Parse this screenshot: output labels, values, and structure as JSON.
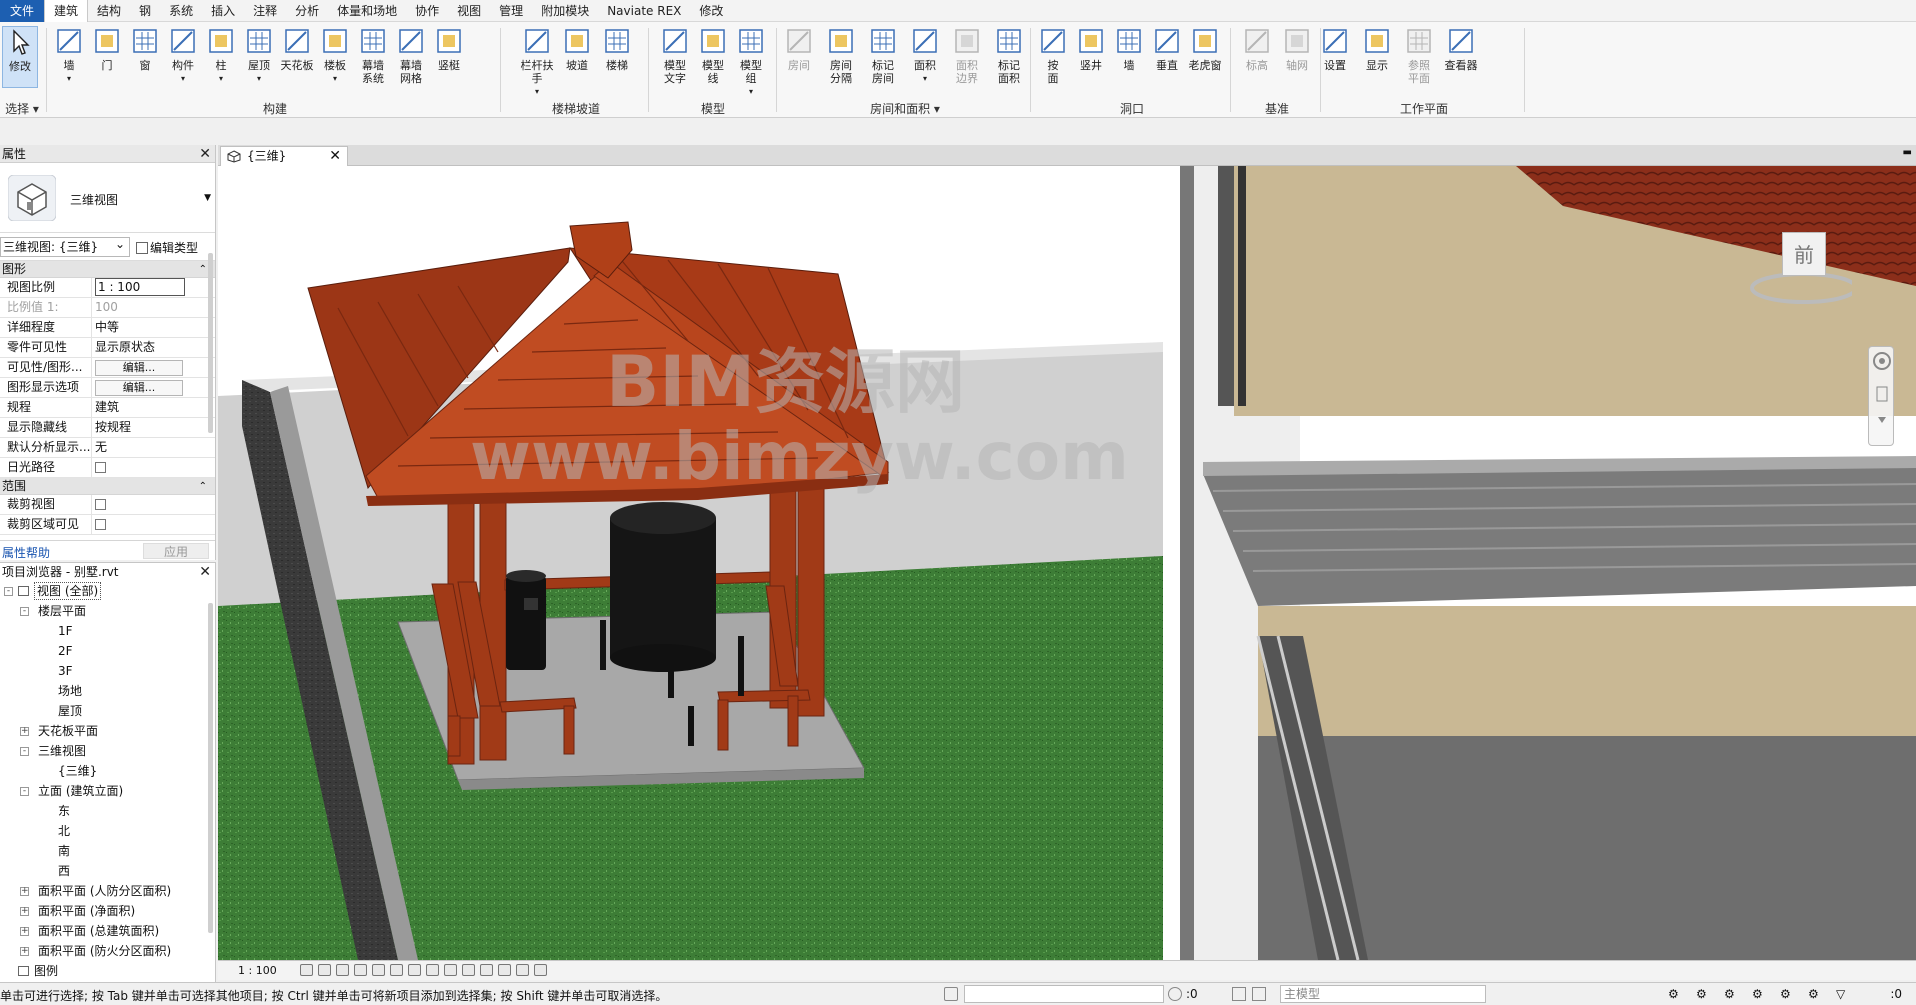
{
  "menu": {
    "tabs": [
      "文件",
      "建筑",
      "结构",
      "钢",
      "系统",
      "插入",
      "注释",
      "分析",
      "体量和场地",
      "协作",
      "视图",
      "管理",
      "附加模块",
      "Naviate REX",
      "修改"
    ],
    "active": "建筑"
  },
  "ribbon": {
    "select": {
      "modify": "修改",
      "select_label": "选择"
    },
    "build": {
      "label": "构建",
      "items": [
        "墙",
        "门",
        "窗",
        "构件",
        "柱",
        "屋顶",
        "天花板",
        "楼板",
        "幕墙\n系统",
        "幕墙\n网格",
        "竖梃"
      ]
    },
    "circulation": {
      "label": "楼梯坡道",
      "items": [
        "栏杆扶手",
        "坡道",
        "楼梯"
      ]
    },
    "model": {
      "label": "模型",
      "items": [
        "模型\n文字",
        "模型\n线",
        "模型\n组"
      ]
    },
    "room": {
      "label": "房间和面积",
      "items": [
        "房间",
        "房间\n分隔",
        "标记\n房间",
        "面积",
        "面积\n边界",
        "标记\n面积"
      ]
    },
    "opening": {
      "label": "洞口",
      "items": [
        "按\n面",
        "竖井",
        "墙",
        "垂直",
        "老虎窗"
      ]
    },
    "datum": {
      "label": "基准",
      "items": [
        "标高",
        "轴网"
      ]
    },
    "workplane": {
      "label": "工作平面",
      "items": [
        "设置",
        "显示",
        "参照\n平面",
        "查看器"
      ]
    }
  },
  "properties": {
    "title": "属性",
    "type_name": "三维视图",
    "view_select": "三维视图: {三维}",
    "edit_type": "编辑类型",
    "graphics_group": "图形",
    "rows": [
      {
        "k": "视图比例",
        "v": "1 : 100",
        "kind": "box"
      },
      {
        "k": "比例值 1:",
        "v": "100",
        "kind": "dim"
      },
      {
        "k": "详细程度",
        "v": "中等"
      },
      {
        "k": "零件可见性",
        "v": "显示原状态"
      },
      {
        "k": "可见性/图形...",
        "v": "编辑...",
        "kind": "btn"
      },
      {
        "k": "图形显示选项",
        "v": "编辑...",
        "kind": "btn"
      },
      {
        "k": "规程",
        "v": "建筑"
      },
      {
        "k": "显示隐藏线",
        "v": "按规程"
      },
      {
        "k": "默认分析显示...",
        "v": "无"
      },
      {
        "k": "日光路径",
        "v": "",
        "kind": "cb"
      }
    ],
    "extents_group": "范围",
    "extent_rows": [
      {
        "k": "裁剪视图",
        "v": "",
        "kind": "cb"
      },
      {
        "k": "裁剪区域可见",
        "v": "",
        "kind": "cb"
      }
    ],
    "help": "属性帮助",
    "apply": "应用"
  },
  "browser": {
    "title": "项目浏览器 - 别墅.rvt",
    "tree": [
      {
        "label": "视图 (全部)",
        "level": 0,
        "toggle": "-",
        "selected": true
      },
      {
        "label": "楼层平面",
        "level": 1,
        "toggle": "-"
      },
      {
        "label": "1F",
        "level": 2
      },
      {
        "label": "2F",
        "level": 2
      },
      {
        "label": "3F",
        "level": 2
      },
      {
        "label": "场地",
        "level": 2
      },
      {
        "label": "屋顶",
        "level": 2
      },
      {
        "label": "天花板平面",
        "level": 1,
        "toggle": "+"
      },
      {
        "label": "三维视图",
        "level": 1,
        "toggle": "-"
      },
      {
        "label": "{三维}",
        "level": 2
      },
      {
        "label": "立面 (建筑立面)",
        "level": 1,
        "toggle": "-"
      },
      {
        "label": "东",
        "level": 2
      },
      {
        "label": "北",
        "level": 2
      },
      {
        "label": "南",
        "level": 2
      },
      {
        "label": "西",
        "level": 2
      },
      {
        "label": "面积平面 (人防分区面积)",
        "level": 1,
        "toggle": "+"
      },
      {
        "label": "面积平面 (净面积)",
        "level": 1,
        "toggle": "+"
      },
      {
        "label": "面积平面 (总建筑面积)",
        "level": 1,
        "toggle": "+"
      },
      {
        "label": "面积平面 (防火分区面积)",
        "level": 1,
        "toggle": "+"
      },
      {
        "label": "图例",
        "level": 0,
        "toggle": "",
        "icon": true
      }
    ]
  },
  "view": {
    "tab_label": "{三维}",
    "watermark_1": "BIM资源网",
    "watermark_2": "www.bimzyw.com",
    "viewcube_face": "前",
    "scale": "1 : 100"
  },
  "status": {
    "text": "单击可进行选择; 按 Tab 键并单击可选择其他项目; 按 Ctrl 键并单击可将新项目添加到选择集; 按 Shift 键并单击可取消选择。",
    "sel_count": ":0",
    "model": "主模型",
    "filter_count": ":0"
  },
  "colors": {
    "accent": "#1d5fb1",
    "roof": "#b8451d",
    "grass": "#3a7a33",
    "paving": "#a9a9a9"
  }
}
